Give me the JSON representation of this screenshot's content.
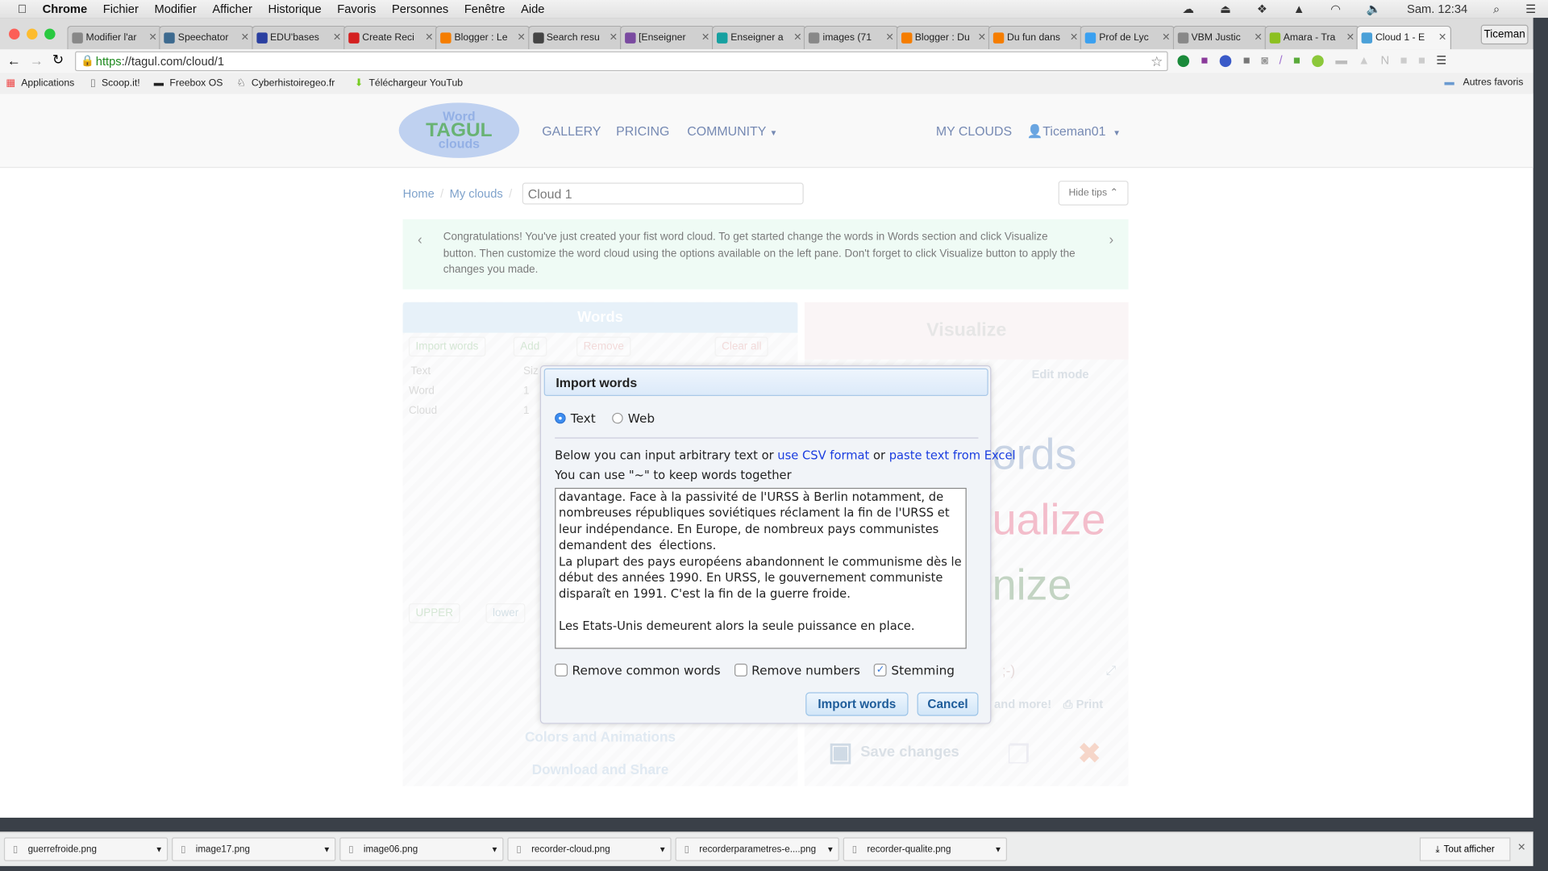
{
  "menubar": {
    "app": "Chrome",
    "items": [
      "Fichier",
      "Modifier",
      "Afficher",
      "Historique",
      "Favoris",
      "Personnes",
      "Fenêtre",
      "Aide"
    ],
    "clock": "Sam. 12:34"
  },
  "tabs": [
    {
      "label": "Modifier l'ar",
      "icon": "page-icon",
      "color": "#888888"
    },
    {
      "label": "Speechator",
      "icon": "speechator-icon",
      "color": "#3d6a8f"
    },
    {
      "label": "EDU'bases",
      "icon": "edubases-icon",
      "color": "#2a3fa0"
    },
    {
      "label": "Create Reci",
      "icon": "create-icon",
      "color": "#d42020"
    },
    {
      "label": "Blogger : Le",
      "icon": "blogger-icon",
      "color": "#f57d00"
    },
    {
      "label": "Search resu",
      "icon": "search-results-icon",
      "color": "#444444"
    },
    {
      "label": "[Enseigner",
      "icon": "enseigner-icon",
      "color": "#7a4aa0"
    },
    {
      "label": "Enseigner a",
      "icon": "edubases-icon",
      "color": "#16a0a0"
    },
    {
      "label": "images (71",
      "icon": "page-icon",
      "color": "#888888"
    },
    {
      "label": "Blogger : Du",
      "icon": "blogger-icon",
      "color": "#f57d00"
    },
    {
      "label": "Du fun dans",
      "icon": "blogger-icon",
      "color": "#f57d00"
    },
    {
      "label": "Prof de Lyc",
      "icon": "twitter-icon",
      "color": "#3aa0f0"
    },
    {
      "label": "VBM Justic",
      "icon": "page-icon",
      "color": "#888888"
    },
    {
      "label": "Amara - Tra",
      "icon": "amara-icon",
      "color": "#8cc020"
    },
    {
      "label": "Cloud 1 - E",
      "icon": "cloud-icon",
      "color": "#4aa0d8",
      "active": true
    }
  ],
  "profile": "Ticeman",
  "url": {
    "scheme": "https",
    "rest": "://tagul.com/cloud/1"
  },
  "bookmarks": [
    "Applications",
    "Scoop.it!",
    "Freebox OS",
    "Cyberhistoiregeo.fr",
    "Téléchargeur YouTub"
  ],
  "other_bookmarks": "Autres favoris",
  "site": {
    "logo_text": "Word TAGUL clouds",
    "nav": [
      "GALLERY",
      "PRICING",
      "COMMUNITY"
    ],
    "my_clouds": "MY CLOUDS",
    "user": "Ticeman01"
  },
  "breadcrumb": {
    "home": "Home",
    "my_clouds": "My clouds",
    "cloud_name": "Cloud 1"
  },
  "hide_tips": "Hide tips",
  "tip": "Congratulations! You've just created your fist word cloud. To get started change the words in Words section and click Visualize button. Then customize the word cloud using the options available on the left pane. Don't forget to click Visualize button to apply the changes you made.",
  "words_panel": {
    "title": "Words",
    "buttons": [
      "Import words",
      "Add",
      "Remove",
      "Clear all"
    ],
    "columns": [
      "Text",
      "Siz"
    ],
    "rows": [
      {
        "text": "Word",
        "size": "1"
      },
      {
        "text": "Cloud",
        "size": "1"
      }
    ],
    "case_buttons": [
      "UPPER",
      "lower"
    ],
    "sections": [
      "Colors and Animations",
      "Download and Share"
    ]
  },
  "right_panel": {
    "visualize": "Visualize",
    "edit_mode": "Edit mode",
    "preview_words": [
      "ords",
      "ualize",
      "nize"
    ],
    "smiley": ";-)",
    "and_more": "and more!",
    "print": "Print",
    "save": "Save changes"
  },
  "dialog": {
    "title": "Import words",
    "source_options": [
      {
        "label": "Text",
        "selected": true
      },
      {
        "label": "Web",
        "selected": false
      }
    ],
    "intro_before": "Below you can input arbitrary text or ",
    "link_csv": "use CSV format",
    "intro_or": " or ",
    "link_excel": "paste text from Excel",
    "hint": "You can use \"~\" to keep words together",
    "text": "davantage. Face à la passivité de l'URSS à Berlin notamment, de nombreuses républiques soviétiques réclament la fin de l'URSS et leur indépendance. En Europe, de nombreux pays communistes demandent des  élections.\nLa plupart des pays européens abandonnent le communisme dès le début des années 1990. En URSS, le gouvernement communiste disparaît en 1991. C'est la fin de la guerre froide.\n\nLes Etats-Unis demeurent alors la seule puissance en place.",
    "options": [
      {
        "label": "Remove common words",
        "checked": false
      },
      {
        "label": "Remove numbers",
        "checked": false
      },
      {
        "label": "Stemming",
        "checked": true
      }
    ],
    "import_button": "Import words",
    "cancel_button": "Cancel"
  },
  "downloads": [
    "guerrefroide.png",
    "image17.png",
    "image06.png",
    "recorder-cloud.png",
    "recorderparametres-e....png",
    "recorder-qualite.png"
  ],
  "show_all": "Tout afficher"
}
